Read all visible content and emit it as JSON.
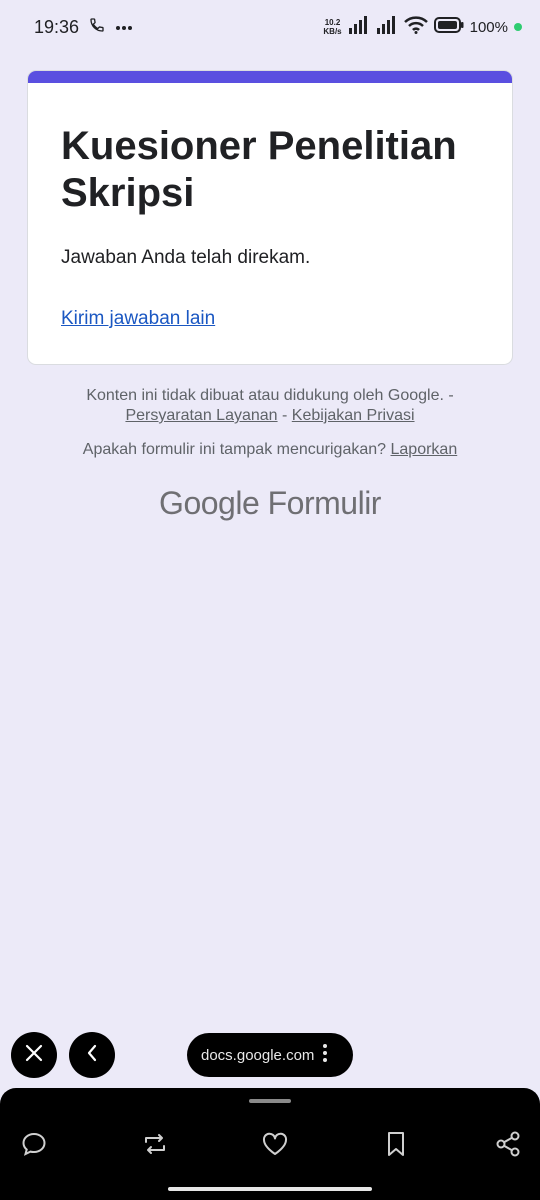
{
  "status_bar": {
    "time": "19:36",
    "net_speed_value": "10.2",
    "net_speed_unit": "KB/s",
    "battery": "100%"
  },
  "form": {
    "title": "Kuesioner Penelitian Skripsi",
    "confirmation": "Jawaban Anda telah direkam.",
    "submit_another": "Kirim jawaban lain",
    "accent_color": "#5A4FE0"
  },
  "footer": {
    "disclaimer": "Konten ini tidak dibuat atau didukung oleh Google. -",
    "terms": "Persyaratan Layanan",
    "separator": "-",
    "privacy": "Kebijakan Privasi",
    "suspicious": "Apakah formulir ini tampak mencurigakan?",
    "report": "Laporkan",
    "brand_google": "Google",
    "brand_product": "Formulir"
  },
  "browser": {
    "url": "docs.google.com"
  },
  "icons": {
    "close": "close-icon",
    "back": "chevron-left-icon",
    "more": "more-vert-icon",
    "reply": "comment-icon",
    "repost": "repost-icon",
    "like": "heart-icon",
    "bookmark": "bookmark-icon",
    "share": "share-icon"
  }
}
